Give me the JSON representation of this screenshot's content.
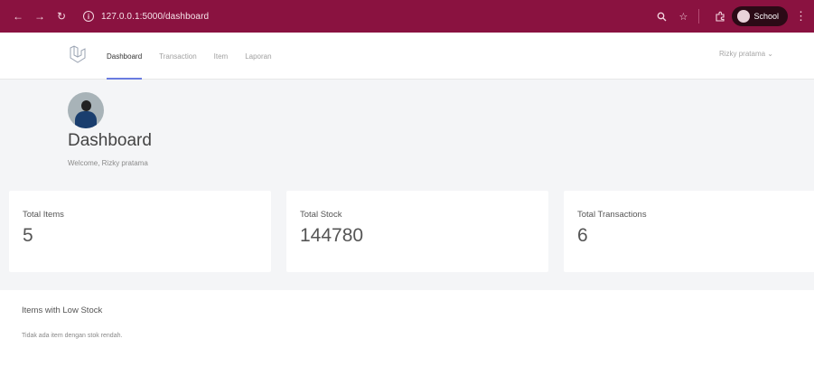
{
  "browser": {
    "url": "127.0.0.1:5000/dashboard",
    "profile_label": "School"
  },
  "nav": {
    "links": [
      "Dashboard",
      "Transaction",
      "Item",
      "Laporan"
    ],
    "active": "Dashboard",
    "user_menu": "Rizky pratama"
  },
  "header": {
    "title": "Dashboard",
    "welcome": "Welcome, Rizky pratama"
  },
  "stats": [
    {
      "label": "Total Items",
      "value": "5"
    },
    {
      "label": "Total Stock",
      "value": "144780"
    },
    {
      "label": "Total Transactions",
      "value": "6"
    }
  ],
  "low_stock": {
    "title": "Items with Low Stock",
    "message": "Tidak ada item dengan stok rendah."
  },
  "colors": {
    "browser_bar": "#8a1240",
    "accent": "#6a7ce0",
    "section_bg": "#f4f5f7"
  }
}
